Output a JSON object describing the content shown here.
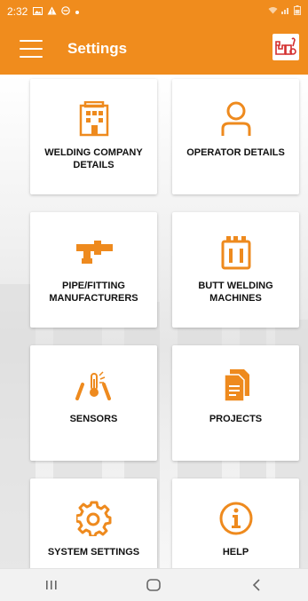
{
  "status_bar": {
    "time": "2:32",
    "icons": [
      "image-icon",
      "alert-icon",
      "do-not-disturb-icon",
      "dot-icon"
    ],
    "right_icons": [
      "wifi-icon",
      "signal-icon",
      "battery-icon"
    ]
  },
  "app_bar": {
    "title": "Settings",
    "menu_icon": "hamburger-menu-icon",
    "logo_icon": "brand-logo-icon"
  },
  "tiles": [
    {
      "label": "WELDING COMPANY\nDETAILS",
      "icon": "building-icon"
    },
    {
      "label": "OPERATOR DETAILS",
      "icon": "user-icon"
    },
    {
      "label": "PIPE/FITTING\nMANUFACTURERS",
      "icon": "pipe-fitting-icon"
    },
    {
      "label": "BUTT WELDING\nMACHINES",
      "icon": "welding-machine-icon"
    },
    {
      "label": "SENSORS",
      "icon": "sensor-thermometer-icon"
    },
    {
      "label": "PROJECTS",
      "icon": "document-icon"
    },
    {
      "label": "SYSTEM SETTINGS",
      "icon": "gear-icon"
    },
    {
      "label": "HELP",
      "icon": "info-icon"
    }
  ],
  "nav_bar": {
    "recents_icon": "recents-icon",
    "home_icon": "home-icon",
    "back_icon": "back-icon"
  },
  "colors": {
    "accent": "#f08c1d",
    "icon": "#ee8a1e",
    "logo_red": "#d32f2f"
  }
}
